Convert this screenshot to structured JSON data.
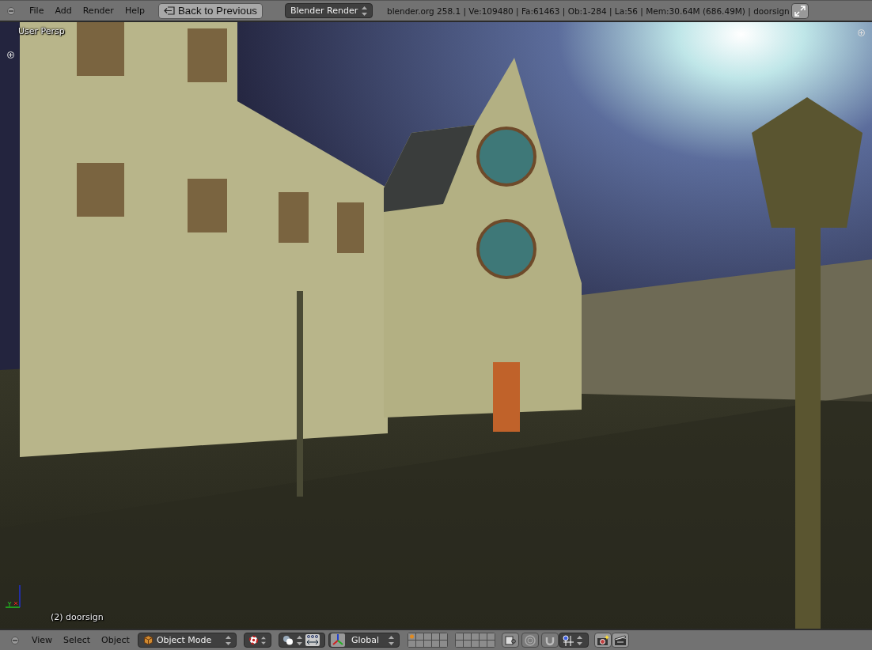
{
  "top_bar": {
    "menus": [
      "File",
      "Add",
      "Render",
      "Help"
    ],
    "back_button": "Back to Previous",
    "render_engine": "Blender Render",
    "stats": "blender.org 258.1 | Ve:109480 | Fa:61463 | Ob:1-284 | La:56 | Mem:30.64M (686.49M) | doorsign"
  },
  "viewport": {
    "view_label": "User Persp",
    "object_label": "(2) doorsign"
  },
  "bottom_bar": {
    "menus": [
      "View",
      "Select",
      "Object"
    ],
    "mode": "Object Mode",
    "orientation": "Global"
  }
}
